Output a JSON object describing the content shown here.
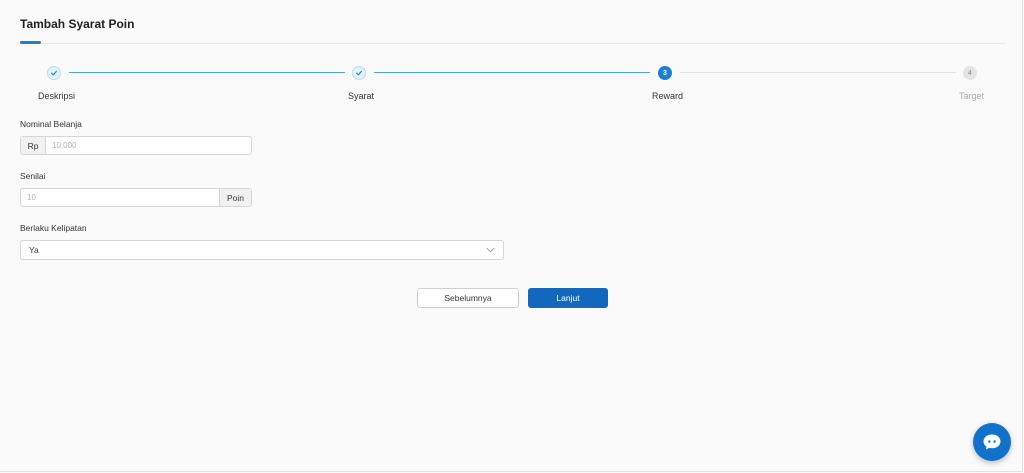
{
  "page": {
    "title": "Tambah Syarat Poin"
  },
  "steps": [
    {
      "number": "1",
      "label": "Deskripsi",
      "status": "done"
    },
    {
      "number": "2",
      "label": "Syarat",
      "status": "done"
    },
    {
      "number": "3",
      "label": "Reward",
      "status": "active"
    },
    {
      "number": "4",
      "label": "Target",
      "status": "todo"
    }
  ],
  "form": {
    "nominal_belanja": {
      "label": "Nominal Belanja",
      "prefix": "Rp",
      "value": "",
      "placeholder": "10,000"
    },
    "senilai": {
      "label": "Senilai",
      "suffix": "Poin",
      "value": "",
      "placeholder": "10"
    },
    "berlaku_kelipatan": {
      "label": "Berlaku Kelipatan",
      "selected": "Ya"
    }
  },
  "actions": {
    "previous_label": "Sebelumnya",
    "next_label": "Lanjut"
  },
  "colors": {
    "primary": "#1168bd",
    "accent": "#1e7ed1",
    "chat_fab": "#1272c9"
  },
  "icons": {
    "done_step": "check-icon",
    "select": "chevron-down-icon",
    "chat": "chat-bubble-icon"
  }
}
